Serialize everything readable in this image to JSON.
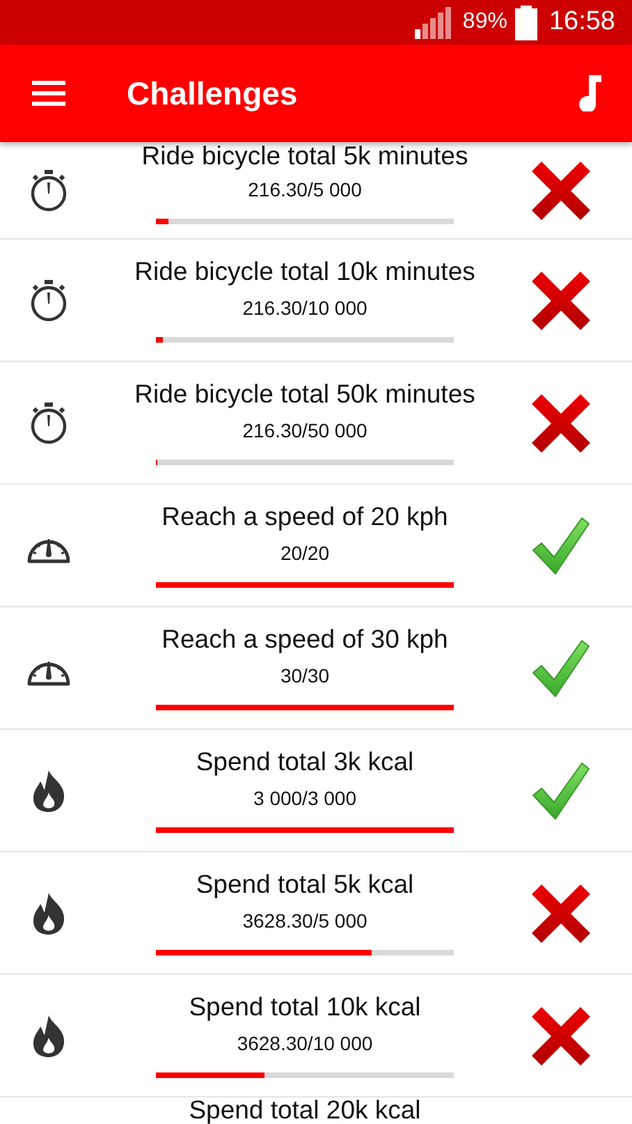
{
  "status_bar": {
    "battery": "89%",
    "time": "16:58"
  },
  "toolbar": {
    "title": "Challenges"
  },
  "challenges": [
    {
      "kind": "stopwatch",
      "title": "Ride bicycle total 5k minutes",
      "progress": "216.30/5 000",
      "level": 0.043,
      "completed": false
    },
    {
      "kind": "stopwatch",
      "title": "Ride bicycle total 10k minutes",
      "progress": "216.30/10 000",
      "level": 0.022,
      "completed": false
    },
    {
      "kind": "stopwatch",
      "title": "Ride bicycle total 50k minutes",
      "progress": "216.30/50 000",
      "level": 0.004,
      "completed": false
    },
    {
      "kind": "speedometer",
      "title": "Reach a speed of 20 kph",
      "progress": "20/20",
      "level": 1,
      "completed": true
    },
    {
      "kind": "speedometer",
      "title": "Reach a speed of 30 kph",
      "progress": "30/30",
      "level": 1,
      "completed": true
    },
    {
      "kind": "flame",
      "title": "Spend total 3k kcal",
      "progress": "3 000/3 000",
      "level": 1,
      "completed": true
    },
    {
      "kind": "flame",
      "title": "Spend total 5k kcal",
      "progress": "3628.30/5 000",
      "level": 0.726,
      "completed": false
    },
    {
      "kind": "flame",
      "title": "Spend total 10k kcal",
      "progress": "3628.30/10 000",
      "level": 0.363,
      "completed": false
    },
    {
      "title": "Spend total 20k kcal"
    }
  ]
}
